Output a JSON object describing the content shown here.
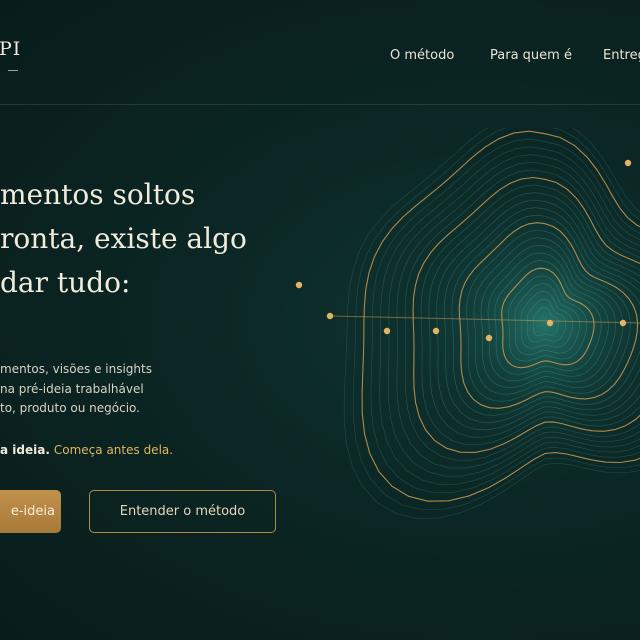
{
  "brand": {
    "mark": "PI"
  },
  "nav": {
    "items": [
      {
        "label": "O método"
      },
      {
        "label": "Para quem é"
      },
      {
        "label": "Entreg"
      }
    ]
  },
  "hero": {
    "headline": [
      "mentos soltos",
      "ronta, existe algo",
      "dar tudo:"
    ],
    "body": [
      "mentos, visões e insights",
      "na pré-ideia trabalhável",
      "to, produto ou negócio."
    ],
    "tagline_strong": "a ideia.",
    "tagline_accent": "Começa antes dela.",
    "primary_cta": "e-ideia",
    "secondary_cta": "Entender o método"
  },
  "colors": {
    "background": "#0b2624",
    "accent_gold": "#c89b52",
    "text": "#f1ebdb",
    "contour_teal": "#3f8f84"
  },
  "graphic": {
    "icon": "topographic-contour-graphic"
  }
}
